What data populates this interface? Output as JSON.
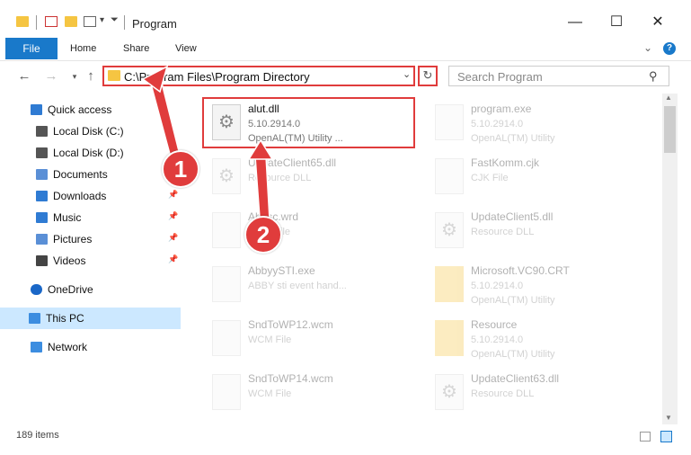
{
  "window": {
    "title": "Program",
    "controls": {
      "minimize": "—",
      "maximize": "☐",
      "close": "✕"
    }
  },
  "ribbon": {
    "tabs": [
      "File",
      "Home",
      "Share",
      "View"
    ],
    "expand": "⌄",
    "help": "?"
  },
  "address_bar": {
    "path": "C:\\Program Files\\Program Directory",
    "refresh": "↻"
  },
  "search": {
    "placeholder": "Search Program"
  },
  "nav": [
    {
      "label": "Quick access",
      "icon": "star-icon",
      "pinned": false,
      "selected": false
    },
    {
      "label": "Local Disk (C:)",
      "icon": "drive-icon",
      "pinned": true,
      "selected": false
    },
    {
      "label": "Local Disk (D:)",
      "icon": "drive-icon",
      "pinned": true,
      "selected": false
    },
    {
      "label": "Documents",
      "icon": "documents-icon",
      "pinned": true,
      "selected": false
    },
    {
      "label": "Downloads",
      "icon": "downloads-icon",
      "pinned": true,
      "selected": false
    },
    {
      "label": "Music",
      "icon": "music-icon",
      "pinned": true,
      "selected": false
    },
    {
      "label": "Pictures",
      "icon": "pictures-icon",
      "pinned": true,
      "selected": false
    },
    {
      "label": "Videos",
      "icon": "videos-icon",
      "pinned": true,
      "selected": false
    },
    {
      "label": "OneDrive",
      "icon": "cloud-icon",
      "pinned": false,
      "selected": false
    },
    {
      "label": "This PC",
      "icon": "pc-icon",
      "pinned": false,
      "selected": true
    },
    {
      "label": "Network",
      "icon": "network-icon",
      "pinned": false,
      "selected": false
    }
  ],
  "files": [
    {
      "name": "alut.dll",
      "line2": "5.10.2914.0",
      "line3": "OpenAL(TM) Utility ...",
      "highlighted": true
    },
    {
      "name": "program.exe",
      "line2": "5.10.2914.0",
      "line3": "OpenAL(TM) Utility",
      "highlighted": false
    },
    {
      "name": "UpdateClient65.dll",
      "line2": "Resource DLL",
      "line3": "",
      "highlighted": false
    },
    {
      "name": "FastKomm.cjk",
      "line2": "CJK File",
      "line3": "",
      "highlighted": false
    },
    {
      "name": "Abbsc.wrd",
      "line2": "WRD File",
      "line3": "",
      "highlighted": false
    },
    {
      "name": "UpdateClient5.dll",
      "line2": "Resource DLL",
      "line3": "",
      "highlighted": false
    },
    {
      "name": "AbbyySTI.exe",
      "line2": "ABBY sti event hand...",
      "line3": "",
      "highlighted": false
    },
    {
      "name": "Microsoft.VC90.CRT",
      "line2": "5.10.2914.0",
      "line3": "OpenAL(TM) Utility",
      "highlighted": false
    },
    {
      "name": "SndToWP12.wcm",
      "line2": "WCM File",
      "line3": "",
      "highlighted": false
    },
    {
      "name": "Resource",
      "line2": "5.10.2914.0",
      "line3": "OpenAL(TM) Utility",
      "highlighted": false
    },
    {
      "name": "SndToWP14.wcm",
      "line2": "WCM File",
      "line3": "",
      "highlighted": false
    },
    {
      "name": "UpdateClient63.dll",
      "line2": "Resource DLL",
      "line3": "",
      "highlighted": false
    }
  ],
  "status": {
    "items": "189 items"
  },
  "callouts": [
    "1",
    "2"
  ],
  "colors": {
    "accent": "#1979ca",
    "highlight": "#e03c3c",
    "selected": "#cce8ff"
  }
}
